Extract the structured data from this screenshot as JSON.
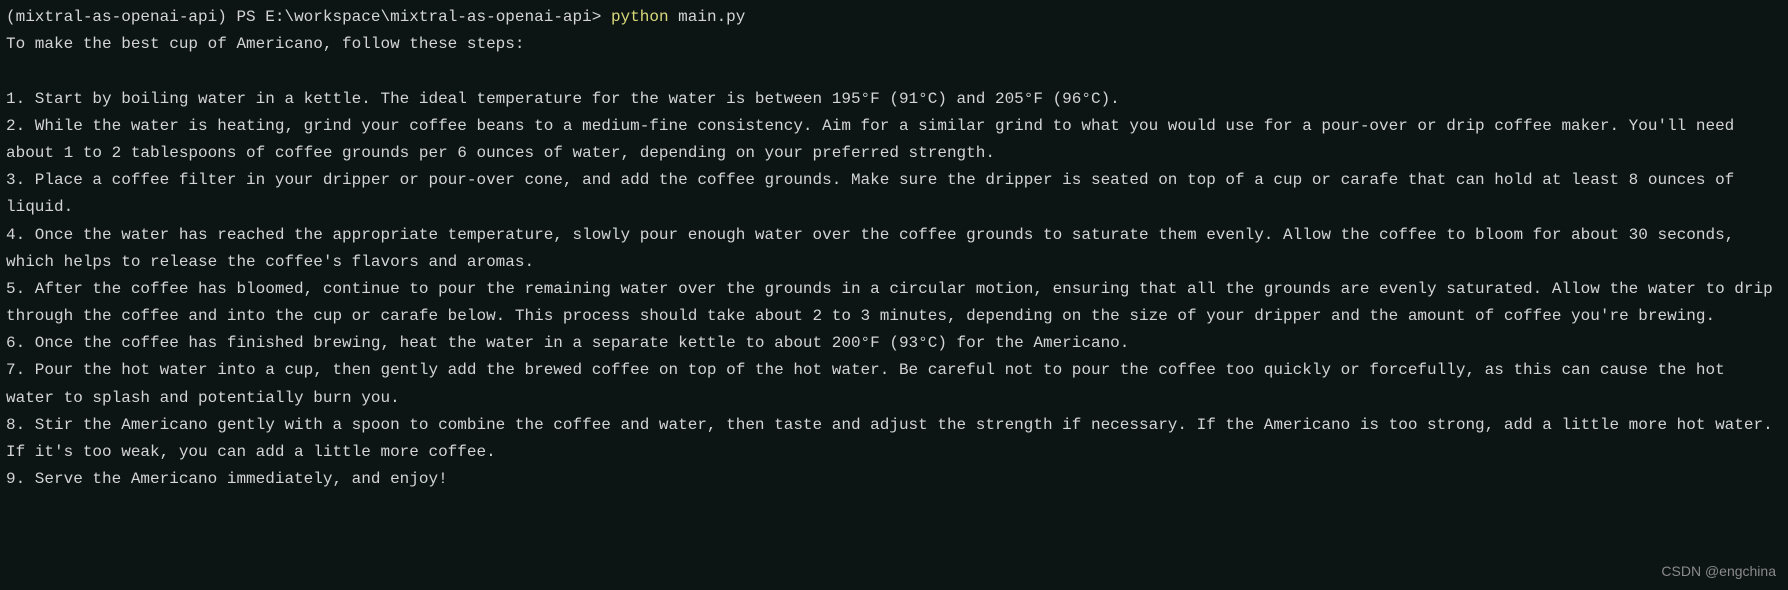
{
  "prompt": {
    "env": "(mixtral-as-openai-api)",
    "shell": "PS",
    "path": "E:\\workspace\\mixtral-as-openai-api>",
    "command": "python",
    "args": "main.py"
  },
  "output": {
    "intro": "To make the best cup of Americano, follow these steps:",
    "steps": [
      "1. Start by boiling water in a kettle. The ideal temperature for the water is between 195°F (91°C) and 205°F (96°C).",
      "2. While the water is heating, grind your coffee beans to a medium-fine consistency. Aim for a similar grind to what you would use for a pour-over or drip coffee maker. You'll need about 1 to 2 tablespoons of coffee grounds per 6 ounces of water, depending on your preferred strength.",
      "3. Place a coffee filter in your dripper or pour-over cone, and add the coffee grounds. Make sure the dripper is seated on top of a cup or carafe that can hold at least 8 ounces of liquid.",
      "4. Once the water has reached the appropriate temperature, slowly pour enough water over the coffee grounds to saturate them evenly. Allow the coffee to bloom for about 30 seconds, which helps to release the coffee's flavors and aromas.",
      "5. After the coffee has bloomed, continue to pour the remaining water over the grounds in a circular motion, ensuring that all the grounds are evenly saturated. Allow the water to drip through the coffee and into the cup or carafe below. This process should take about 2 to 3 minutes, depending on the size of your dripper and the amount of coffee you're brewing.",
      "6. Once the coffee has finished brewing, heat the water in a separate kettle to about 200°F (93°C) for the Americano.",
      "7. Pour the hot water into a cup, then gently add the brewed coffee on top of the hot water. Be careful not to pour the coffee too quickly or forcefully, as this can cause the hot water to splash and potentially burn you.",
      "8. Stir the Americano gently with a spoon to combine the coffee and water, then taste and adjust the strength if necessary. If the Americano is too strong, add a little more hot water. If it's too weak, you can add a little more coffee.",
      "9. Serve the Americano immediately, and enjoy!"
    ]
  },
  "watermark": "CSDN @engchina"
}
